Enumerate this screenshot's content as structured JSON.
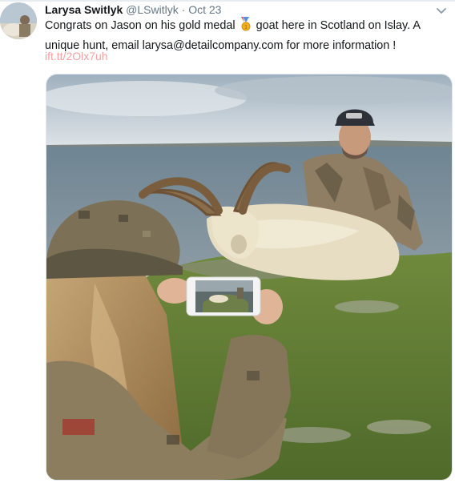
{
  "tweet": {
    "author_name": "Larysa Switlyk",
    "handle": "@LSwitlyk",
    "separator": "·",
    "date": "Oct 23",
    "text_part1": "Congrats on Jason on his gold medal",
    "medal_icon": "gold-medal-icon",
    "text_part2": "goat here in Scotland on Islay.  A unique hunt, email larysa@detailcompany.com for more information !",
    "link": "ift.tt/2Olx7uh"
  },
  "icons": {
    "menu": "chevron-down-icon",
    "medal": "medal-icon"
  },
  "colors": {
    "link": "#f3a3a3",
    "secondary_text": "#657786",
    "primary_text": "#14171a"
  }
}
